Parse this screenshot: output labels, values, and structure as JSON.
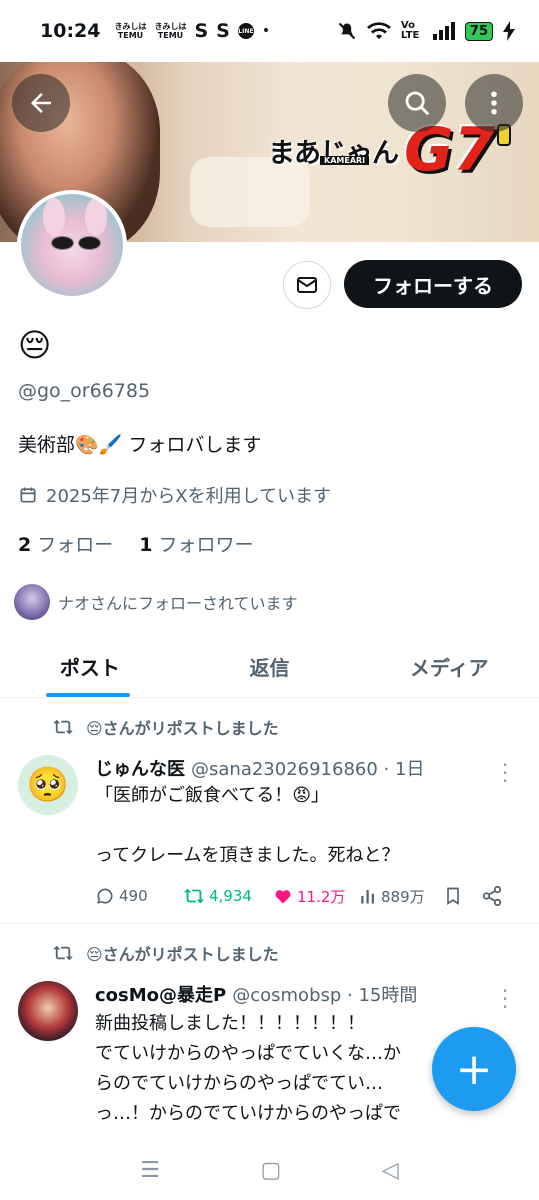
{
  "status_bar": {
    "time": "10:24",
    "app_icons": [
      "TEMU",
      "TEMU",
      "S",
      "S",
      "LINE",
      "•"
    ],
    "network": "Vo LTE",
    "battery": "75"
  },
  "banner": {
    "logo_text": "まあじゃん",
    "logo_sub": "KAMEARI",
    "logo_g7": "G7"
  },
  "profile": {
    "display_name": "😔",
    "handle": "@go_or66785",
    "bio": "美術部🎨🖌️ フォロバします",
    "joined": "2025年7月からXを利用しています",
    "following_count": "2",
    "following_label": "フォロー",
    "followers_count": "1",
    "followers_label": "フォロワー",
    "followed_by": "ナオさんにフォローされています",
    "follow_button": "フォローする"
  },
  "tabs": [
    {
      "label": "ポスト",
      "active": true
    },
    {
      "label": "返信",
      "active": false
    },
    {
      "label": "メディア",
      "active": false
    }
  ],
  "posts": [
    {
      "repost_by": "😔さんがリポストしました",
      "avatar": "🥺",
      "name": "じゅんな医",
      "meta": "@sana23026916860 · 1日",
      "body": "「医師がご飯食べてる！😡」\n\nってクレームを頂きました。死ねと？",
      "replies": "490",
      "reposts": "4,934",
      "likes": "11.2万",
      "views": "889万"
    },
    {
      "repost_by": "😔さんがリポストしました",
      "name": "cosMo@暴走P",
      "meta": "@cosmobsp · 15時間",
      "body": "新曲投稿しました！！！！！！！\nでていけからのやっぱでていくな…か\nらのでていけからのやっぱでてい…\nっ…！からのでていけからのやっぱで"
    }
  ],
  "fab_label": "+",
  "nav": {
    "recents": "☰",
    "home": "▢",
    "back": "◁"
  }
}
